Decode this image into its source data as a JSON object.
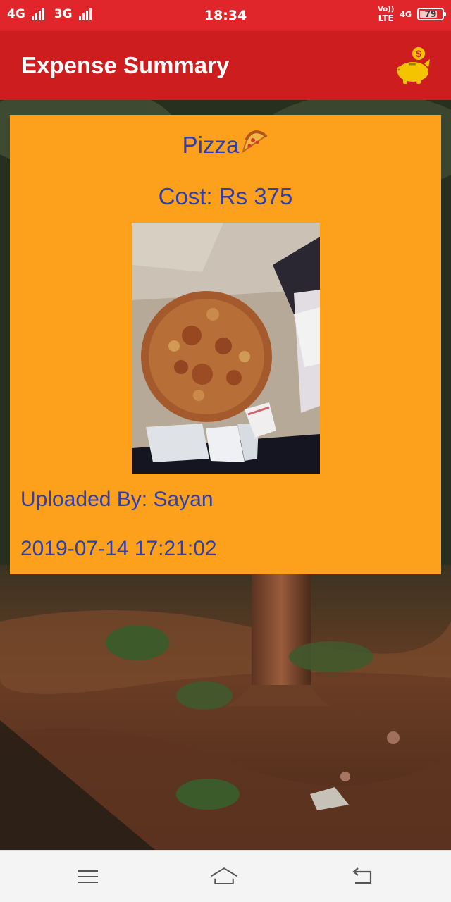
{
  "status_bar": {
    "network_1": "4G",
    "network_2": "3G",
    "time": "18:34",
    "volte_top": "Vo))",
    "volte_bottom": "LTE",
    "network_3": "4G",
    "battery_level": "79",
    "battery_percent": 79
  },
  "app_bar": {
    "title": "Expense Summary",
    "action_icon": "piggy-bank-coin-icon"
  },
  "expense": {
    "item": "Pizza",
    "item_icon": "pizza-slice-icon",
    "cost": "Cost: Rs 375",
    "uploaded_by": "Uploaded By: Sayan",
    "datetime": "2019-07-14 17:21:02"
  },
  "nav_bar": {
    "menu_icon": "menu-icon",
    "home_icon": "home-icon",
    "back_icon": "back-icon"
  },
  "colors": {
    "status_bar": "#e0262a",
    "app_bar": "#cd1d1f",
    "card": "#fda11d",
    "card_text": "#2f3fb0",
    "icon_gold": "#f5c400"
  }
}
